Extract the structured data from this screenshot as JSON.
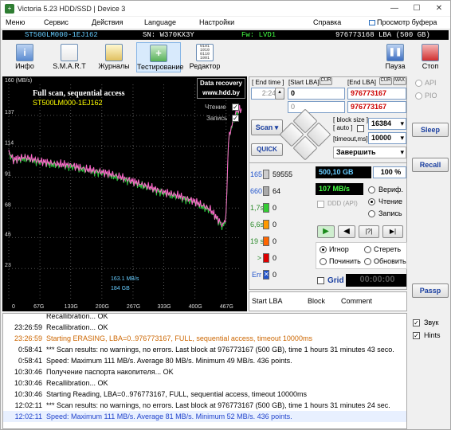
{
  "window": {
    "title": "Victoria 5.23 HDD/SSD | Device 3",
    "min": "—",
    "max": "☐",
    "close": "✕"
  },
  "menu": [
    "Меню",
    "Сервис",
    "Действия",
    "Language",
    "Настройки",
    "Справка"
  ],
  "menu_right": "Просмотр буфера",
  "info": {
    "model": "ST500LM000-1EJ162",
    "serial": "SN: W370KX3Y",
    "fw": "Fw: LVD1",
    "capacity": "976773168 LBA (500 GB)"
  },
  "toolbar": {
    "info": "Инфо",
    "smart": "S.M.A.R.T",
    "journals": "Журналы",
    "test": "Тестирование",
    "editor": "Редактор",
    "pause": "Пауза",
    "stop": "Стоп"
  },
  "graph": {
    "ymax_label": "160 (MB/s)",
    "title1": "Full scan, sequential access",
    "title2": "ST500LM000-1EJ162",
    "watermark1": "Data recovery",
    "watermark2": "www.hdd.by",
    "legend_read": "Чтение",
    "legend_write": "Запись",
    "yticks": [
      "137",
      "114",
      "91",
      "68",
      "46",
      "23"
    ],
    "xticks": [
      "0",
      "67G",
      "133G",
      "200G",
      "267G",
      "333G",
      "400G",
      "467G"
    ],
    "note1": "163.1 MB/s",
    "note2": "184 GB",
    "colors": {
      "read": "#2ecc40",
      "write": "#ff66cc",
      "grid": "#555555"
    }
  },
  "chart_data": {
    "type": "line",
    "title": "Full scan, sequential access",
    "subtitle": "ST500LM000-1EJ162",
    "xlabel": "",
    "ylabel": "(MB/s)",
    "ylim": [
      0,
      160
    ],
    "xlim_gb": [
      0,
      500
    ],
    "series": [
      {
        "name": "Чтение",
        "x": [
          0,
          10,
          33,
          67,
          100,
          133,
          167,
          200,
          233,
          267,
          300,
          333,
          367,
          400,
          433,
          460,
          467,
          472,
          478,
          482,
          490,
          500
        ],
        "values": [
          110,
          104,
          106,
          103,
          101,
          100,
          97,
          95,
          92,
          88,
          84,
          80,
          77,
          73,
          67,
          55,
          62,
          118,
          128,
          134,
          140,
          142
        ]
      },
      {
        "name": "Запись",
        "x": [
          0,
          10,
          33,
          67,
          100,
          133,
          167,
          200,
          233,
          267,
          300,
          333,
          367,
          400,
          433,
          460,
          467,
          472,
          478,
          482,
          490,
          500
        ],
        "values": [
          109,
          103,
          105,
          102,
          100,
          99,
          96,
          94,
          91,
          87,
          83,
          79,
          76,
          72,
          66,
          54,
          61,
          117,
          127,
          133,
          139,
          141
        ]
      }
    ]
  },
  "controls": {
    "end_time_label": "[ End time ]",
    "end_time": "2:24",
    "start_lba_label": "[Start LBA]",
    "cur_label": "CUR",
    "start_lba": "0",
    "start_lba2": "0",
    "end_lba_label": "[End LBA]",
    "cur2": "CUR",
    "max_label": "MAX",
    "end_lba": "976773167",
    "end_lba2": "976773167",
    "block_size_label": "[ block size ]",
    "auto_label": "[ auto ]",
    "block_size": "16384",
    "timeout_label": "[timeout,ms]",
    "timeout": "10000",
    "scan": "Scan",
    "quick": "QUICK",
    "finish": "Завершить"
  },
  "stats": {
    "counts": [
      {
        "label": "165",
        "value": "59555",
        "color": "#cccccc"
      },
      {
        "label": "660",
        "value": "64",
        "color": "#aaaaaa"
      },
      {
        "label": "1,7s",
        "value": "0",
        "color": "#33cc33"
      },
      {
        "label": "6,6s",
        "value": "0",
        "color": "#ff9900"
      },
      {
        "label": "19 s",
        "value": "0",
        "color": "#ff6600"
      },
      {
        "label": ">",
        "value": "0",
        "color": "#dd0000"
      },
      {
        "label": "Err",
        "value": "0",
        "color": "#2255cc"
      }
    ],
    "position": "500,10 GB",
    "percent": "100",
    "percent_unit": "%",
    "speed": "107 MB/s",
    "verify": "Вериф.",
    "read": "Чтение",
    "write": "Запись",
    "ddd": "DDD (API)",
    "ignore": "Игнор",
    "erase": "Стереть",
    "repair": "Починить",
    "refresh": "Обновить",
    "grid": "Grid",
    "timer": "00:00:00",
    "cols": [
      "Start LBA",
      "Block",
      "Comment"
    ]
  },
  "right": {
    "api": "API",
    "pio": "PIO",
    "sleep": "Sleep",
    "recall": "Recall",
    "passp": "Passp",
    "sound": "Звук",
    "hints": "Hints"
  },
  "log": [
    {
      "t": "",
      "m": "Recallibration... OK",
      "c": "#000000"
    },
    {
      "t": "23:26:59",
      "m": "Recallibration... OK",
      "c": "#000000"
    },
    {
      "t": "23:26:59",
      "m": "Starting ERASING, LBA=0..976773167, FULL, sequential access, timeout 10000ms",
      "c": "#cc6600"
    },
    {
      "t": "0:58:41",
      "m": "*** Scan results: no warnings, no errors. Last block at 976773167 (500 GB), time 1 hours 31 minutes 43 seco.",
      "c": "#000000"
    },
    {
      "t": "0:58:41",
      "m": "Speed: Maximum 111 MB/s. Average 80 MB/s. Minimum 49 MB/s. 436 points.",
      "c": "#000000"
    },
    {
      "t": "10:30:46",
      "m": "Получение паспорта накопителя... OK",
      "c": "#000000"
    },
    {
      "t": "10:30:46",
      "m": "Recallibration... OK",
      "c": "#000000"
    },
    {
      "t": "10:30:46",
      "m": "Starting Reading, LBA=0..976773167, FULL, sequential access, timeout 10000ms",
      "c": "#000000"
    },
    {
      "t": "12:02:11",
      "m": "*** Scan results: no warnings, no errors. Last block at 976773167 (500 GB), time 1 hours 31 minutes 24 sec.",
      "c": "#000000"
    },
    {
      "t": "12:02:11",
      "m": "Speed: Maximum 111 MB/s. Average 81 MB/s. Minimum 52 MB/s. 436 points.",
      "c": "#2244cc"
    }
  ]
}
